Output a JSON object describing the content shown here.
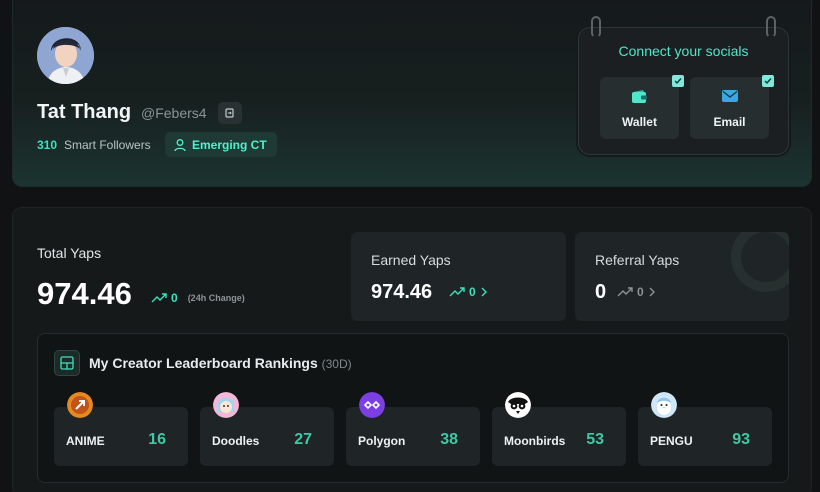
{
  "profile": {
    "name": "Tat Thang",
    "handle": "@Febers4",
    "smart_followers_count": "310",
    "smart_followers_label": "Smart Followers",
    "badge": "Emerging CT"
  },
  "socials": {
    "title": "Connect your socials",
    "items": [
      {
        "label": "Wallet",
        "icon": "wallet-icon",
        "connected": true
      },
      {
        "label": "Email",
        "icon": "email-icon",
        "connected": true
      }
    ]
  },
  "stats": {
    "total_label": "Total Yaps",
    "total_value": "974.46",
    "total_change": "0",
    "change_note": "(24h Change)",
    "earned_label": "Earned Yaps",
    "earned_value": "974.46",
    "earned_change": "0",
    "referral_label": "Referral Yaps",
    "referral_value": "0",
    "referral_change": "0"
  },
  "leaderboard": {
    "title": "My Creator Leaderboard Rankings",
    "period": "(30D)",
    "items": [
      {
        "name": "ANIME",
        "rank": "16"
      },
      {
        "name": "Doodles",
        "rank": "27"
      },
      {
        "name": "Polygon",
        "rank": "38"
      },
      {
        "name": "Moonbirds",
        "rank": "53"
      },
      {
        "name": "PENGU",
        "rank": "93"
      }
    ]
  },
  "colors": {
    "accent": "#3ee0c0",
    "rank": "#3ec9a5",
    "background": "#101213"
  }
}
